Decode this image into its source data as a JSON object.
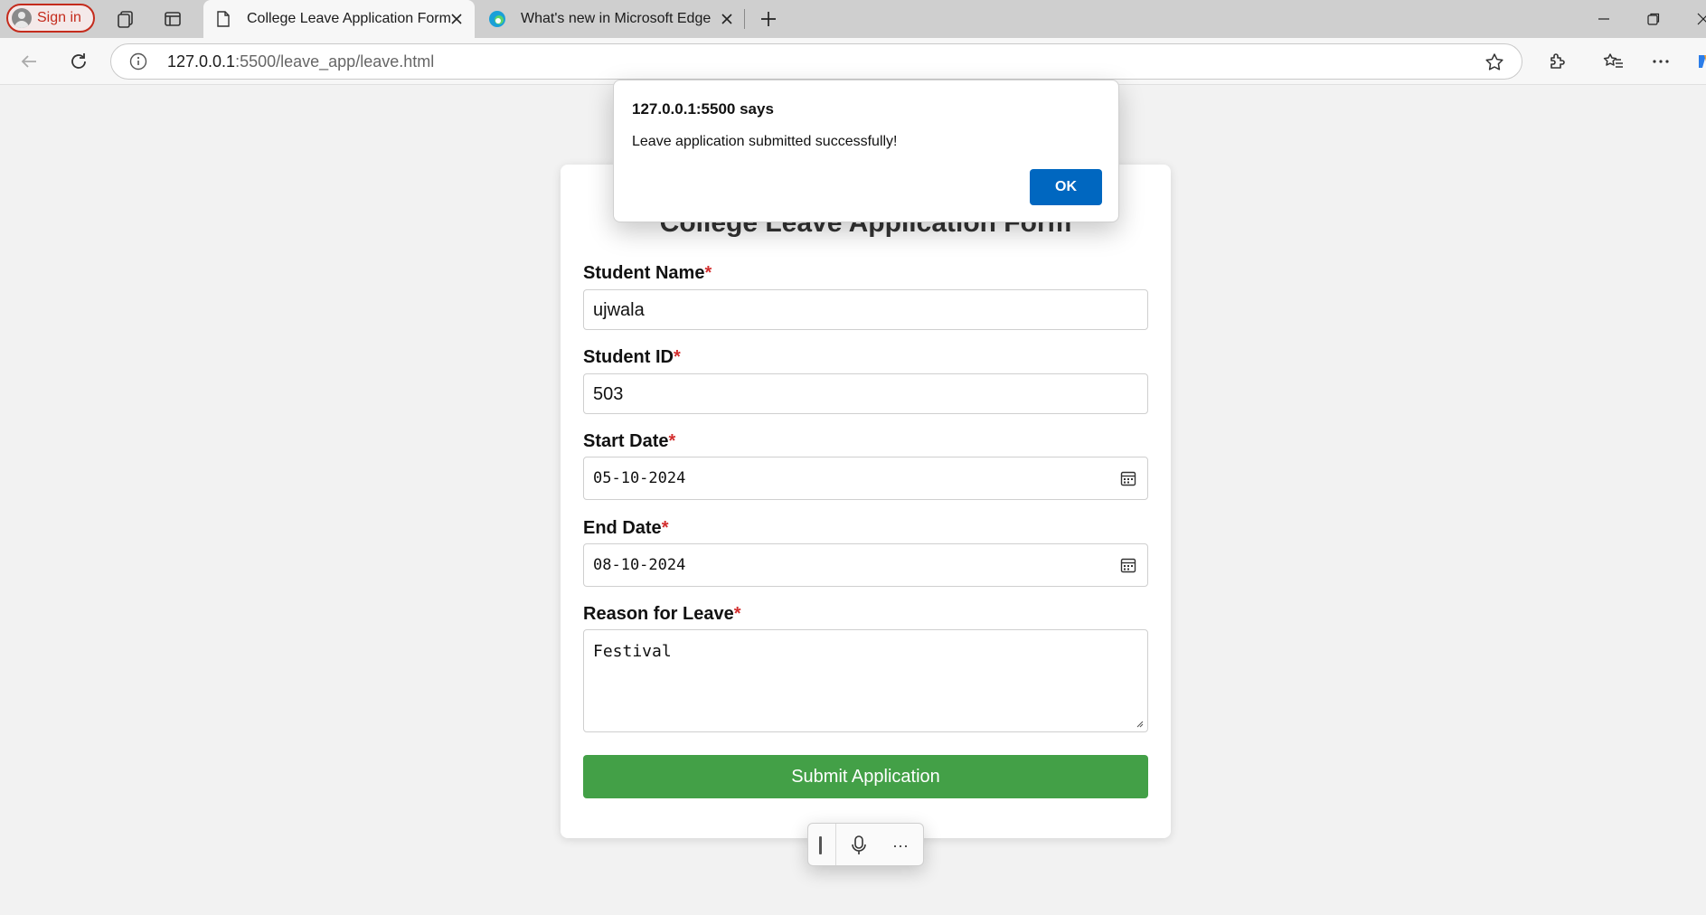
{
  "browser": {
    "sign_in_label": "Sign in",
    "tabs": [
      {
        "title": "College Leave Application Form",
        "icon": "page-icon",
        "active": true
      },
      {
        "title": "What's new in Microsoft Edge",
        "icon": "edge-logo-icon",
        "active": false
      }
    ],
    "address": {
      "host": "127.0.0.1",
      "path": ":5500/leave_app/leave.html"
    }
  },
  "form": {
    "title": "College Leave Application Form",
    "required_mark": "*",
    "fields": {
      "student_name": {
        "label": "Student Name",
        "value": "ujwala"
      },
      "student_id": {
        "label": "Student ID",
        "value": "503"
      },
      "start_date": {
        "label": "Start Date",
        "value": "05-10-2024"
      },
      "end_date": {
        "label": "End Date",
        "value": "08-10-2024"
      },
      "reason": {
        "label": "Reason for Leave",
        "value": "Festival"
      }
    },
    "submit_label": "Submit Application"
  },
  "dialog": {
    "title": "127.0.0.1:5500 says",
    "message": "Leave application submitted successfully!",
    "ok_label": "OK"
  },
  "minibar": {
    "more_label": "···"
  },
  "colors": {
    "submit": "#43a047",
    "required": "#d32f2f",
    "dialog_ok": "#0067c0",
    "sign_in": "#c42b1c"
  }
}
